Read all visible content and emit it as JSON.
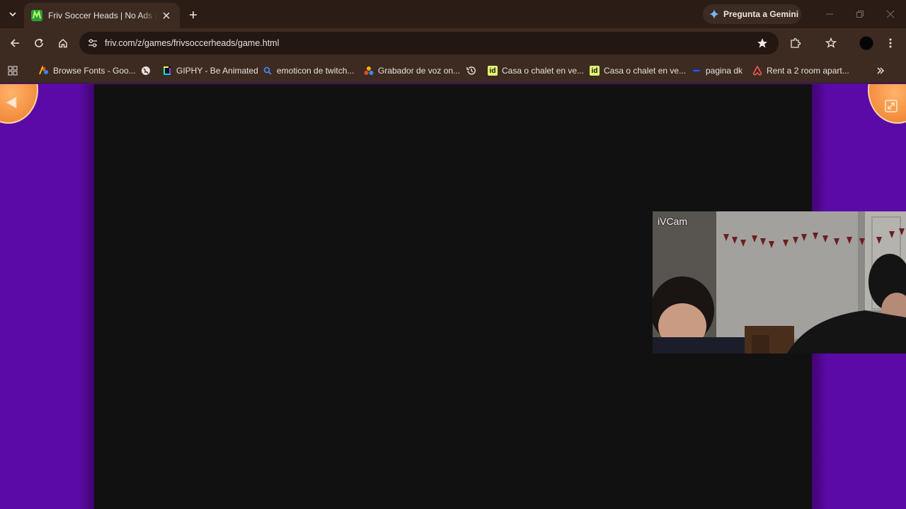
{
  "browser": {
    "tab": {
      "title": "Friv Soccer Heads | No Ads | Play"
    },
    "gemini_label": "Pregunta a Gemini",
    "address_bar": {
      "url": "friv.com/z/games/frivsoccerheads/game.html"
    },
    "bookmarks": [
      {
        "label": "Browse Fonts - Goo...",
        "icon": "google-fonts-icon"
      },
      {
        "label": "",
        "icon": "globe-icon"
      },
      {
        "label": "GIPHY - Be Animated",
        "icon": "giphy-icon"
      },
      {
        "label": "emoticon de twitch...",
        "icon": "search-icon"
      },
      {
        "label": "Grabador de voz on...",
        "icon": "voice-recorder-icon"
      },
      {
        "label": "",
        "icon": "history-icon"
      },
      {
        "label": "Casa o chalet en ve...",
        "icon": "idealista-icon"
      },
      {
        "label": "Casa o chalet en ve...",
        "icon": "idealista-icon"
      },
      {
        "label": "pagina dk",
        "icon": "dk-icon"
      },
      {
        "label": "Rent a 2 room apart...",
        "icon": "airbnb-icon"
      }
    ]
  },
  "camera_overlay": {
    "label": "iVCam"
  },
  "colors": {
    "tab_strip": "#2b1d16",
    "toolbar": "#3d2b22",
    "page_background": "#5b0aa8",
    "game_area": "#111111",
    "bubble_orange": "#f28a3a"
  }
}
